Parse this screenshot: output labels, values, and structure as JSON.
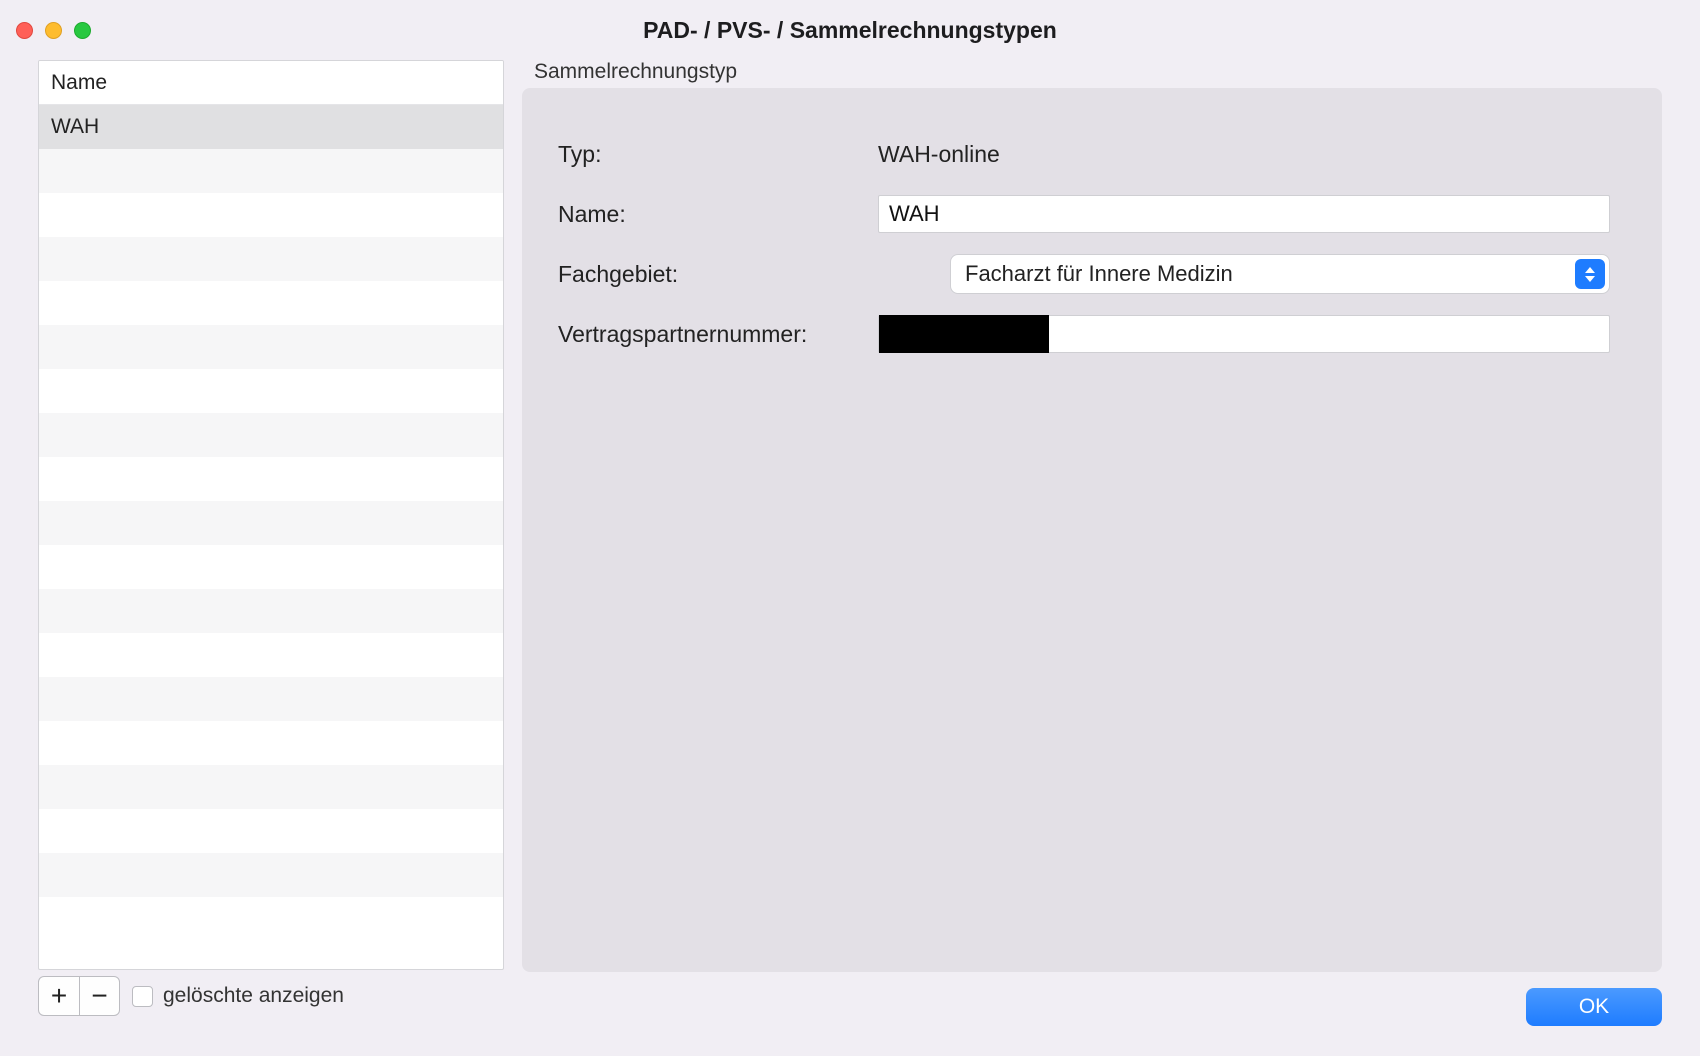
{
  "window_title": "PAD- / PVS- / Sammelrechnungstypen",
  "list": {
    "column_header": "Name",
    "items": [
      "WAH"
    ],
    "selected_index": 0,
    "blank_row_count": 18
  },
  "left_footer": {
    "add_label": "+",
    "remove_label": "−",
    "show_deleted_label": "gelöschte anzeigen",
    "show_deleted_checked": false
  },
  "detail": {
    "group_caption": "Sammelrechnungstyp",
    "labels": {
      "typ": "Typ:",
      "name": "Name:",
      "fachgebiet": "Fachgebiet:",
      "vpnr": "Vertragspartnernummer:"
    },
    "values": {
      "typ": "WAH-online",
      "name": "WAH",
      "fachgebiet": "Facharzt für Innere Medizin",
      "vpnr": ""
    }
  },
  "buttons": {
    "ok": "OK"
  },
  "colors": {
    "accent": "#1e7cff"
  }
}
